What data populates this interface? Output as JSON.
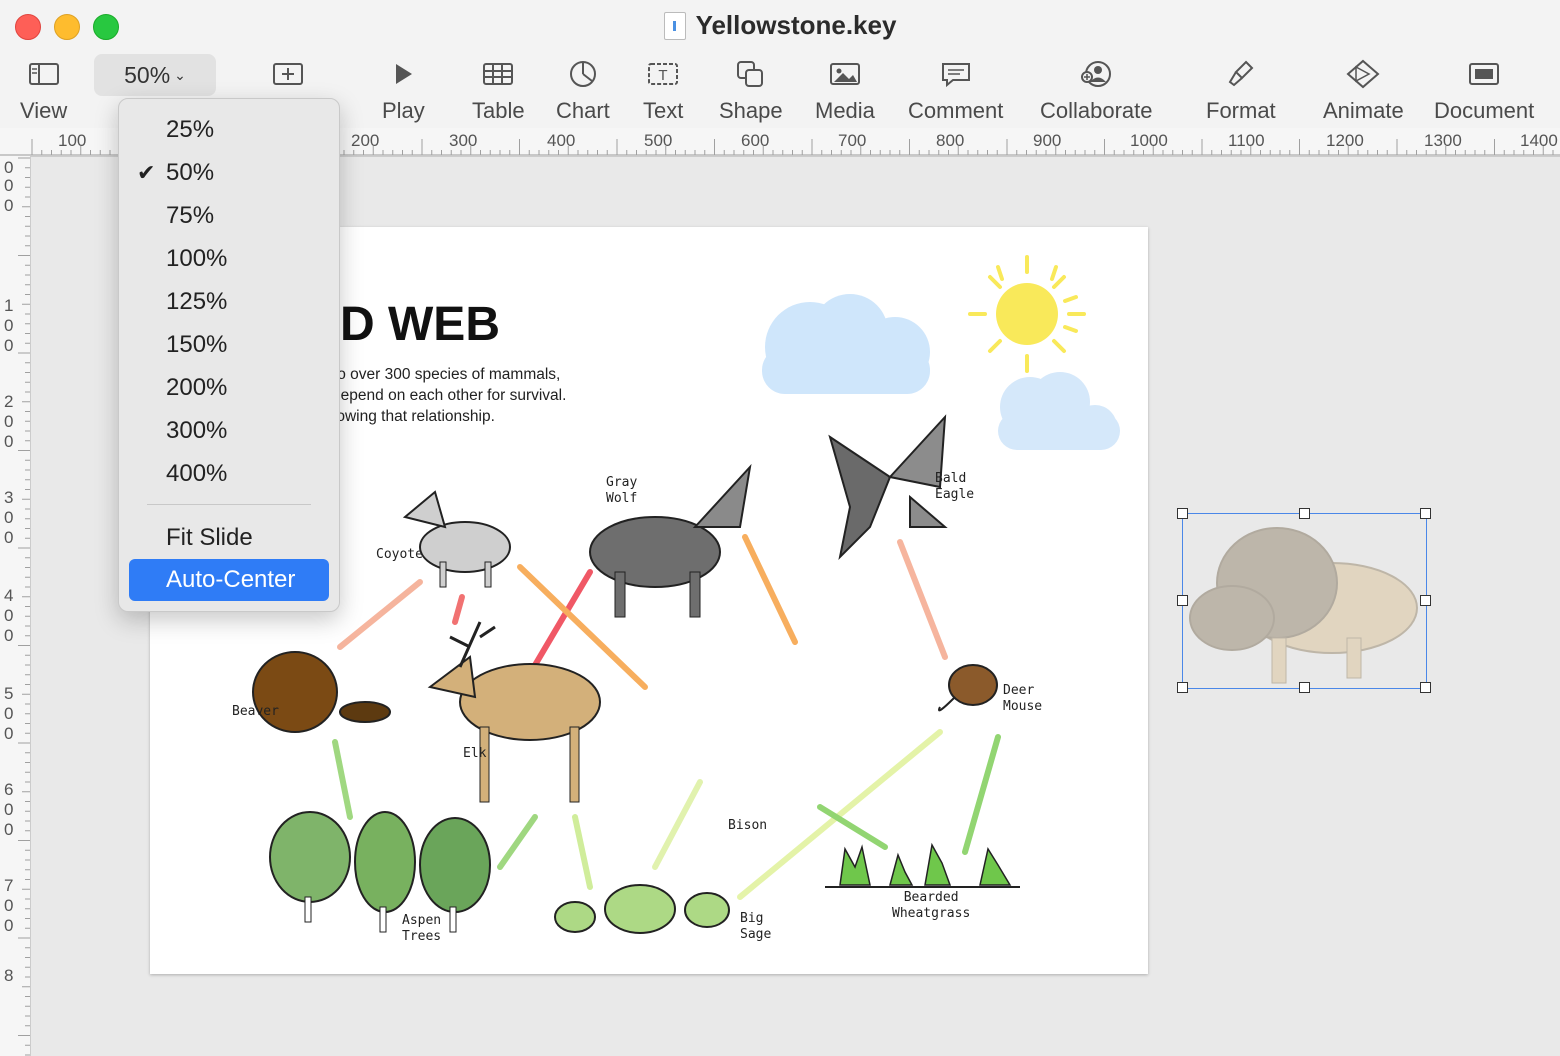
{
  "window": {
    "title": "Yellowstone.key"
  },
  "toolbar": {
    "view_label": "View",
    "zoom_value": "50%",
    "play_label": "Play",
    "table_label": "Table",
    "chart_label": "Chart",
    "text_label": "Text",
    "shape_label": "Shape",
    "media_label": "Media",
    "comment_label": "Comment",
    "collaborate_label": "Collaborate",
    "format_label": "Format",
    "animate_label": "Animate",
    "document_label": "Document"
  },
  "ruler": {
    "h": [
      "100",
      "200",
      "300",
      "400",
      "500",
      "600",
      "700",
      "800",
      "900",
      "1000",
      "1100",
      "1200",
      "1300",
      "1400"
    ],
    "v": [
      "0",
      "0",
      "0",
      "1",
      "0",
      "0",
      "2",
      "0",
      "0",
      "3",
      "0",
      "0",
      "4",
      "0",
      "0",
      "5",
      "0",
      "0",
      "6",
      "0",
      "0",
      "7",
      "0",
      "0",
      "8"
    ]
  },
  "zoom_menu": {
    "items": [
      "25%",
      "50%",
      "75%",
      "100%",
      "125%",
      "150%",
      "200%",
      "300%",
      "400%"
    ],
    "checked": "50%",
    "fit_slide": "Fit Slide",
    "auto_center": "Auto-Center"
  },
  "slide": {
    "title": "D WEB",
    "body": "e to over 300 species of mammals,\ny depend on each other for survival.\nshowing that relationship.",
    "labels": {
      "coyote": "Coyote",
      "gray_wolf": "Gray\nWolf",
      "bald_eagle": "Bald\nEagle",
      "beaver": "Beaver",
      "elk": "Elk",
      "deer_mouse": "Deer\nMouse",
      "bison": "Bison",
      "aspen_trees": "Aspen\nTrees",
      "big_sage": "Big\nSage",
      "bearded_wheatgrass": "Bearded\nWheatgrass"
    }
  },
  "colors": {
    "accent": "#2f7cf6",
    "selection": "#4a87e8",
    "sun": "#f9e95a",
    "cloud": "#cfe6fb"
  }
}
